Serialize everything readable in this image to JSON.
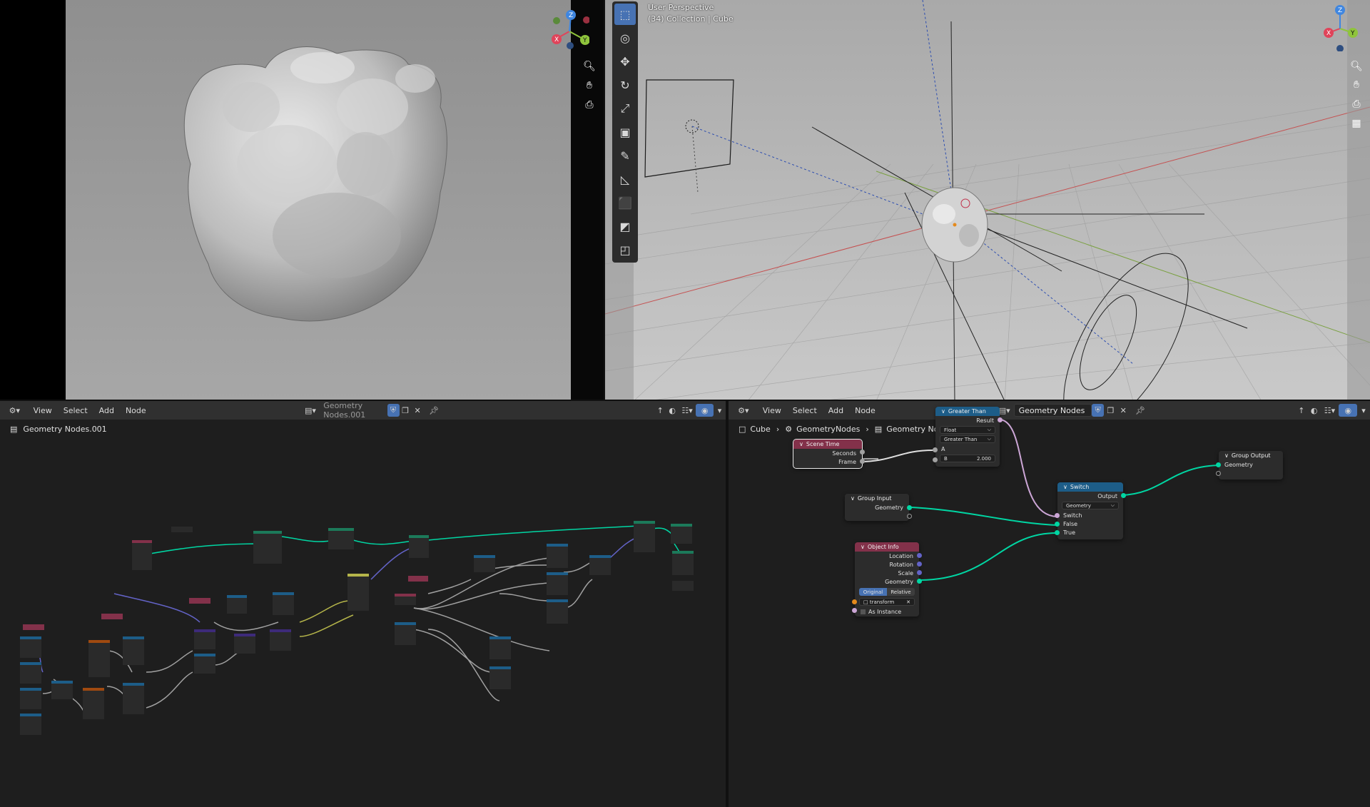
{
  "viewport_right": {
    "mode_label": "User Perspective",
    "collection_label": "(34) Collection | Cube",
    "axis_x": "X",
    "axis_y": "Y",
    "axis_z": "Z"
  },
  "viewport_left": {
    "axis_x": "X",
    "axis_y": "Y",
    "axis_z": "Z"
  },
  "node_editor_left": {
    "menu": [
      "View",
      "Select",
      "Add",
      "Node"
    ],
    "tree_name": "Geometry Nodes.001",
    "breadcrumb": "Geometry Nodes.001"
  },
  "node_editor_right": {
    "menu": [
      "View",
      "Select",
      "Add",
      "Node"
    ],
    "tree_name": "Geometry Nodes",
    "breadcrumb": [
      "Cube",
      "GeometryNodes",
      "Geometry Nodes"
    ],
    "nodes": {
      "scene_time": {
        "title": "Scene Time",
        "out1": "Seconds",
        "out2": "Frame"
      },
      "greater_than": {
        "title": "Greater Than",
        "out": "Result",
        "type": "Float",
        "op": "Greater Than",
        "in_a": "A",
        "in_b_label": "B",
        "in_b_value": "2.000"
      },
      "group_input": {
        "title": "Group Input",
        "out": "Geometry"
      },
      "object_info": {
        "title": "Object Info",
        "out1": "Location",
        "out2": "Rotation",
        "out3": "Scale",
        "out4": "Geometry",
        "mode_a": "Original",
        "mode_b": "Relative",
        "object": "transform",
        "as_instance": "As Instance"
      },
      "switch": {
        "title": "Switch",
        "out": "Output",
        "type": "Geometry",
        "in1": "Switch",
        "in2": "False",
        "in3": "True"
      },
      "group_output": {
        "title": "Group Output",
        "in": "Geometry"
      }
    }
  },
  "colors": {
    "geometry_socket": "#00d6a3",
    "float_socket": "#a1a1a1",
    "boolean_socket": "#cca6d6",
    "vector_socket": "#6363c7",
    "input_header": "#83314a",
    "function_header": "#1d5d88",
    "active_tool": "#4772b3"
  }
}
